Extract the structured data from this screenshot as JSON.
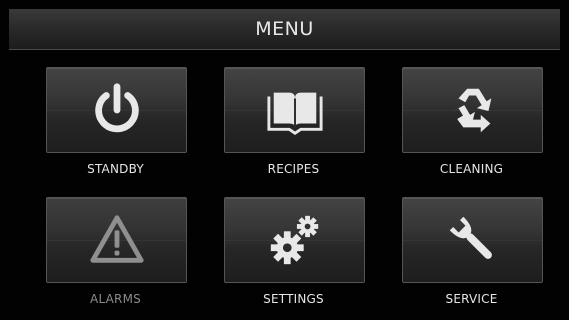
{
  "header": {
    "title": "MENU"
  },
  "menu": {
    "items": [
      {
        "label": "STANDBY",
        "icon": "power-icon"
      },
      {
        "label": "RECIPES",
        "icon": "book-icon"
      },
      {
        "label": "CLEANING",
        "icon": "recycle-icon"
      },
      {
        "label": "ALARMS",
        "icon": "warning-icon",
        "disabled": true
      },
      {
        "label": "SETTINGS",
        "icon": "gears-icon"
      },
      {
        "label": "SERVICE",
        "icon": "wrench-icon"
      }
    ]
  },
  "colors": {
    "icon": "#e8e8e8",
    "icon_disabled": "#8f8f8f",
    "label": "#e6e6e6",
    "label_disabled": "#8a8a8a"
  }
}
